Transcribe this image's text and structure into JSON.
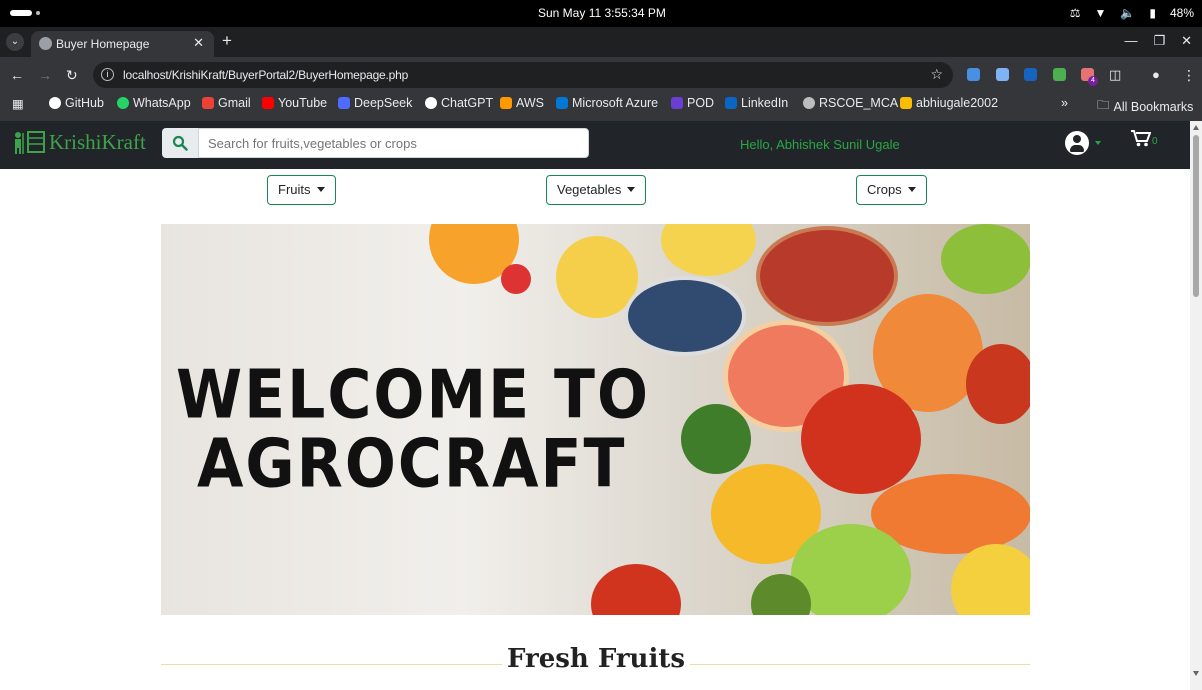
{
  "system": {
    "datetime": "Sun May 11   3:55:34 PM",
    "battery": "48%"
  },
  "browser": {
    "tab_title": "Buyer Homepage",
    "url": "localhost/KrishiKraft/BuyerPortal2/BuyerHomepage.php",
    "bookmarks": [
      {
        "label": "GitHub",
        "color": "#ffffff"
      },
      {
        "label": "WhatsApp",
        "color": "#25d366"
      },
      {
        "label": "Gmail",
        "color": "#ea4335"
      },
      {
        "label": "YouTube",
        "color": "#ff0000"
      },
      {
        "label": "DeepSeek",
        "color": "#4d6bfe"
      },
      {
        "label": "ChatGPT",
        "color": "#ffffff"
      },
      {
        "label": "AWS",
        "color": "#ff9900"
      },
      {
        "label": "Microsoft Azure",
        "color": "#0078d4"
      },
      {
        "label": "POD",
        "color": "#6b3fd1"
      },
      {
        "label": "LinkedIn",
        "color": "#0a66c2"
      },
      {
        "label": "RSCOE_MCA",
        "color": "#bdbdbd"
      },
      {
        "label": "abhiugale2002",
        "color": "#fbbc04"
      }
    ],
    "all_bookmarks": "All Bookmarks",
    "more": "»",
    "ext_badge": "4"
  },
  "site": {
    "logo_text": "KrishiKraft",
    "search_placeholder": "Search for fruits,vegetables or crops",
    "greeting": "Hello, Abhishek Sunil Ugale",
    "cart_count": "0",
    "menus": [
      "Fruits",
      "Vegetables",
      "Crops"
    ],
    "hero_line1": "WELCOME TO",
    "hero_line2": "AGROCRAFT",
    "section_title": "Fresh Fruits"
  },
  "icons": [
    "search-icon",
    "user-icon",
    "cart-icon",
    "star-icon",
    "reload-icon",
    "back-icon",
    "forward-icon"
  ],
  "colors": {
    "brand_green": "#3da34a",
    "navbar": "#212529",
    "button_border": "#198754",
    "divider": "#f2d9a8"
  }
}
